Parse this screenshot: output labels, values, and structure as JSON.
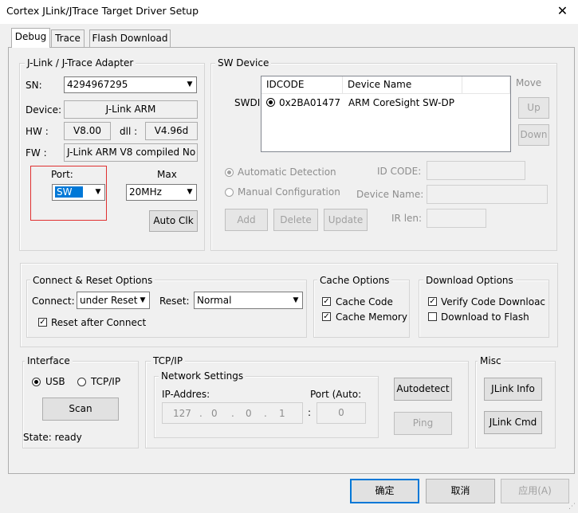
{
  "window": {
    "title": "Cortex JLink/JTrace Target Driver Setup",
    "close_glyph": "✕"
  },
  "tabs": [
    {
      "label": "Debug"
    },
    {
      "label": "Trace"
    },
    {
      "label": "Flash Download"
    }
  ],
  "adapter": {
    "group_label": "J-Link / J-Trace Adapter",
    "sn_label": "SN:",
    "sn_value": "4294967295",
    "device_label": "Device:",
    "device_value": "J-Link ARM",
    "hw_label": "HW :",
    "hw_value": "V8.00",
    "dll_label": "dll :",
    "dll_value": "V4.96d",
    "fw_label": "FW :",
    "fw_value": "J-Link ARM V8 compiled No",
    "port_label": "Port:",
    "port_value": "SW",
    "max_label": "Max",
    "max_value": "20MHz",
    "auto_clk_label": "Auto Clk"
  },
  "sw_device": {
    "group_label": "SW Device",
    "move_label": "Move",
    "up_label": "Up",
    "down_label": "Down",
    "col_idcode": "IDCODE",
    "col_device_name": "Device Name",
    "swdi_label": "SWDI",
    "row_idcode": "0x2BA01477",
    "row_device_name": "ARM CoreSight SW-DP",
    "auto_detection_label": "Automatic Detection",
    "manual_config_label": "Manual Configuration",
    "id_code_label": "ID CODE:",
    "device_name_label": "Device Name:",
    "ir_len_label": "IR len:",
    "add_label": "Add",
    "delete_label": "Delete",
    "update_label": "Update"
  },
  "connect_reset": {
    "group_label": "Connect & Reset Options",
    "connect_label": "Connect:",
    "connect_value": "under Reset",
    "reset_label": "Reset:",
    "reset_value": "Normal",
    "reset_after_connect_label": "Reset after Connect"
  },
  "cache": {
    "group_label": "Cache Options",
    "cache_code_label": "Cache Code",
    "cache_memory_label": "Cache Memory"
  },
  "download": {
    "group_label": "Download Options",
    "verify_label": "Verify Code Downloac",
    "download_flash_label": "Download to Flash"
  },
  "interface": {
    "group_label": "Interface",
    "usb_label": "USB",
    "tcpip_label": "TCP/IP",
    "scan_label": "Scan",
    "state_text": "State: ready"
  },
  "tcpip": {
    "group_label": "TCP/IP",
    "network_settings_label": "Network Settings",
    "ip_label": "IP-Addres:",
    "port_label": "Port (Auto:",
    "ip_octets": [
      "127",
      "0",
      "0",
      "1"
    ],
    "port_value": "0",
    "autodetect_label": "Autodetect",
    "ping_label": "Ping"
  },
  "misc": {
    "group_label": "Misc",
    "jlink_info_label": "JLink Info",
    "jlink_cmd_label": "JLink Cmd"
  },
  "footer": {
    "ok_label": "确定",
    "cancel_label": "取消",
    "apply_label": "应用(A)"
  },
  "colors": {
    "window_bg": "#f0f0f0",
    "highlight_blue": "#0078d7",
    "port_highlight_red": "#e03030"
  }
}
